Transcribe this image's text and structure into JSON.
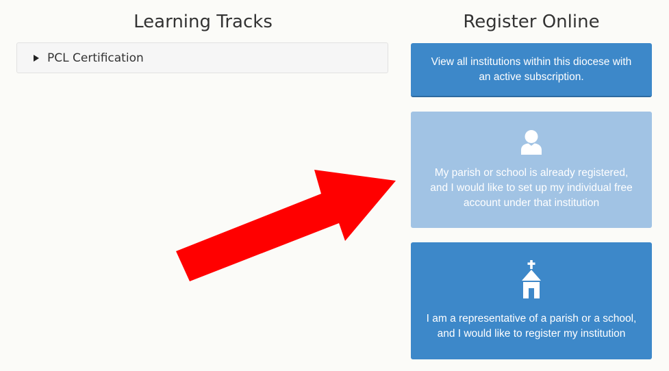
{
  "learning_tracks": {
    "title": "Learning Tracks",
    "items": [
      {
        "label": "PCL Certification",
        "icon": "caret-right-icon"
      }
    ]
  },
  "register_online": {
    "title": "Register Online",
    "buttons": [
      {
        "label": "View all institutions within this diocese with an active subscription."
      },
      {
        "label": "My parish or school is already registered, and I would like to set up my individual free account under that institution",
        "icon": "user-icon"
      },
      {
        "label": "I am a representative of a parish or a school, and I would like to register my institution",
        "icon": "church-icon"
      }
    ]
  },
  "annotation": {
    "icon": "red-arrow-icon",
    "color": "#ff0000"
  },
  "colors": {
    "primary_button": "#3d88c9",
    "muted_button": "#a1c3e4",
    "background": "#fbfbf8"
  }
}
